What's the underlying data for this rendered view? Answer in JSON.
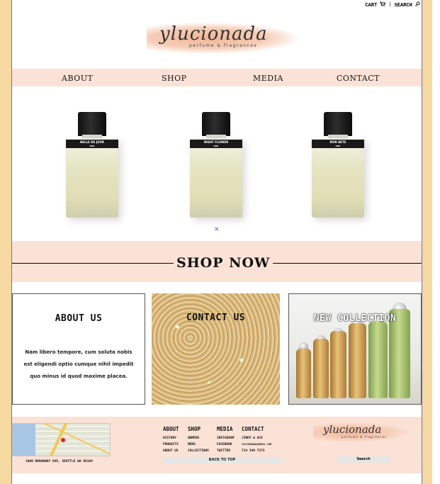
{
  "header": {
    "cart_label": "CART",
    "separator": "|",
    "search_label": "SEARCH",
    "logo_script": "ylucionada",
    "logo_tagline": "perfume & fragrances"
  },
  "nav": {
    "items": [
      {
        "label": "ABOUT"
      },
      {
        "label": "SHOP"
      },
      {
        "label": "MEDIA"
      },
      {
        "label": "CONTACT"
      }
    ]
  },
  "products": [
    {
      "name": "BELLE DE JOUR",
      "sub": "EDS"
    },
    {
      "name": "NIGHT FLOWER",
      "sub": "EDS"
    },
    {
      "name": "MUR BETE",
      "sub": "EDS"
    }
  ],
  "carousel": {
    "close_glyph": "×"
  },
  "shop_now": "SHOP NOW",
  "cards": {
    "about": {
      "title": "ABOUT US",
      "body": "Nam libero tempore, cum soluta nobis est eligendi optio cumque nihil impedit quo minus id quod maxime placea."
    },
    "contact": {
      "title": "CONTACT US"
    },
    "collection": {
      "title": "NEW COLLECTION"
    }
  },
  "footer": {
    "address": "1000 BROADWAY AVE, SEATTLE WA 98104",
    "columns": [
      {
        "heading": "ABOUT",
        "items": [
          "HISTORY",
          "PRODUCTS",
          "ABOUT US"
        ]
      },
      {
        "heading": "SHOP",
        "items": [
          "WOMENS",
          "MENS",
          "COLLECTIONS"
        ]
      },
      {
        "heading": "MEDIA",
        "items": [
          "INSTAGRAM",
          "FACEBOOK",
          "TWITTER"
        ]
      },
      {
        "heading": "CONTACT",
        "items": [
          "JINKY & ACE",
          "YLUCIONADA@GMAIL.COM",
          "714 349 7373"
        ]
      }
    ],
    "back_to_top": "BACK TO TOP",
    "logo_script": "ylucionada",
    "logo_tagline": "perfume & fragrances",
    "search_button": "Search"
  },
  "colors": {
    "side_frame": "#f5d9a0",
    "blush_band": "#fbe2d6",
    "frame_line": "#6a6fd0"
  },
  "icons": {
    "cart": "cart-icon",
    "search": "search-icon"
  }
}
